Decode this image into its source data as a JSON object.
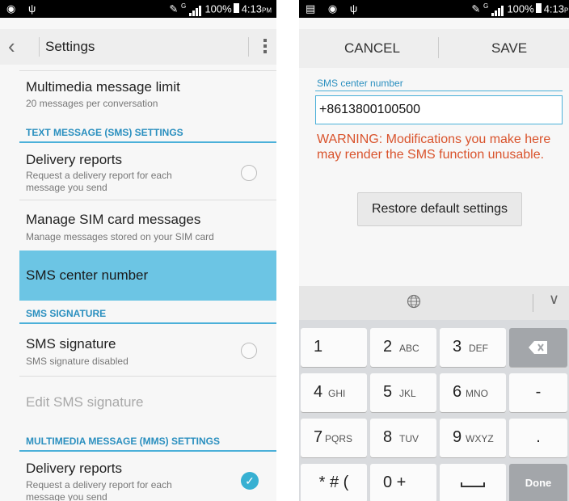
{
  "status": {
    "network": "G",
    "battery": "100%",
    "time": "4:13",
    "ampm": "PM",
    "time_right": "4:13",
    "ampm_right": "PM"
  },
  "settings": {
    "title": "Settings",
    "mms_limit": {
      "title": "Multimedia message limit",
      "summary": "20 messages per conversation"
    },
    "sms_header": "TEXT MESSAGE (SMS) SETTINGS",
    "delivery_reports": {
      "title": "Delivery reports",
      "summary": "Request a delivery report for each message you send"
    },
    "manage_sim": {
      "title": "Manage SIM card messages",
      "summary": "Manage messages stored on your SIM card"
    },
    "sms_center": {
      "title": "SMS center number"
    },
    "signature_header": "SMS SIGNATURE",
    "sms_signature": {
      "title": "SMS signature",
      "summary": "SMS signature disabled"
    },
    "edit_signature": {
      "title": "Edit SMS signature"
    },
    "mms_header": "MULTIMEDIA MESSAGE (MMS) SETTINGS",
    "mms_delivery": {
      "title": "Delivery reports",
      "summary": "Request a delivery report for each message you send"
    }
  },
  "dialog": {
    "cancel": "CANCEL",
    "save": "SAVE",
    "field_label": "SMS center number",
    "field_value": "+8613800100500",
    "warning": "WARNING: Modifications you make here may render the SMS function unusable.",
    "restore": "Restore default settings"
  },
  "keyboard": {
    "keys": [
      {
        "n": "1",
        "l": ""
      },
      {
        "n": "2",
        "l": "ABC"
      },
      {
        "n": "3",
        "l": "DEF"
      },
      {
        "n": "4",
        "l": "GHI"
      },
      {
        "n": "5",
        "l": "JKL"
      },
      {
        "n": "6",
        "l": "MNO"
      },
      {
        "n": "7",
        "l": "PQRS"
      },
      {
        "n": "8",
        "l": "TUV"
      },
      {
        "n": "9",
        "l": "WXYZ"
      }
    ],
    "symbols": "* # (",
    "zero": "0 +",
    "minus": "-",
    "period": ".",
    "done": "Done"
  }
}
